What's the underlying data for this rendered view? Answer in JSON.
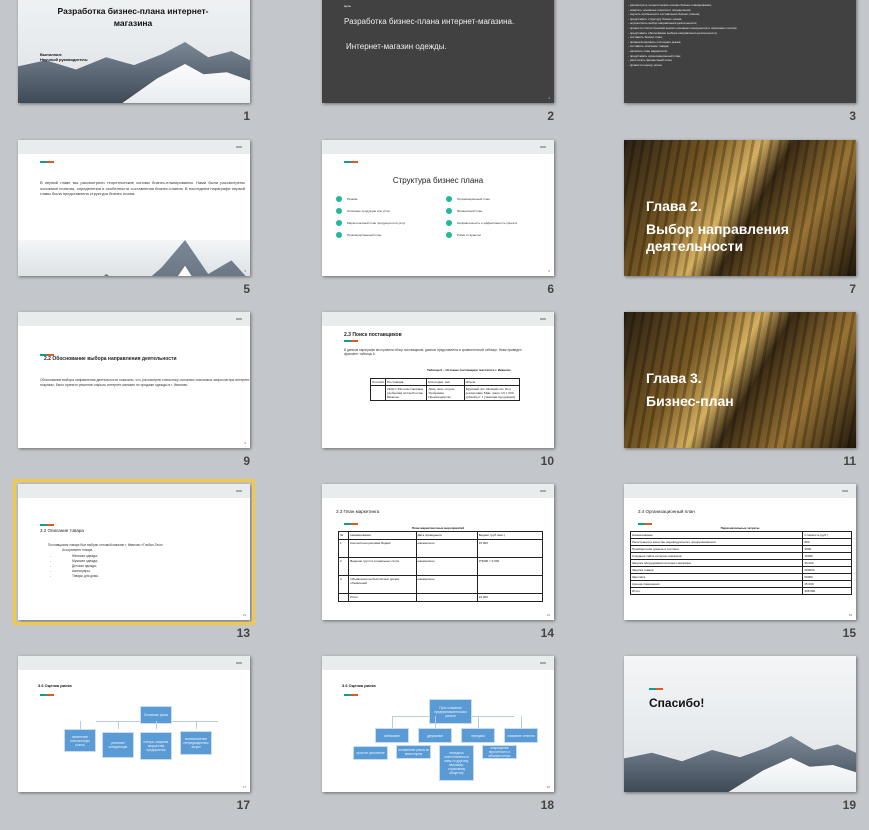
{
  "view": "slide-sorter",
  "selected_slide": 13,
  "colors": {
    "background": "#c3c6ca",
    "selection": "#f2c84b",
    "accent_teal": "#129c8a",
    "accent_orange": "#e45a1c",
    "dark_slide": "#414141",
    "diagram_box": "#5b9bd5"
  },
  "slides": [
    {
      "num": "1",
      "type": "photo-title",
      "title": "Разработка бизнес-плана интернет-магазина",
      "lines": [
        "Выполнил:",
        "Научный руководитель:"
      ]
    },
    {
      "num": "2",
      "type": "dark",
      "label": "Цель",
      "title": "Разработка бизнес-плана интернет-магазина.",
      "subtitle": "Интернет-магазин одежды."
    },
    {
      "num": "3",
      "type": "dark-list",
      "lines": [
        "- рассмотреть теоретические основы бизнес-планирования;",
        "- осветить основные понятия и определения;",
        "- изучить особенности составления бизнес-планов;",
        "- представить структуру бизнес-плана;",
        "- осуществить выбор направления деятельности;",
        "- провести статистический анализ основных конкурентов и поисковых систем;",
        "- представить обоснование выбора направления деятельности;",
        "- составить бизнес-план;",
        "- проанализировать состояние рынка;",
        "- составить описание товара;",
        "- написать план маркетинга;",
        "- представить организационный план;",
        "- рассчитать финансовый план;",
        "- провести оценку риска."
      ]
    },
    {
      "num": "5",
      "type": "text-photo",
      "text": "В первой главе мы рассмотрели теоретические основы бизнес-планирования. Нами были рассмотрены основные понятия, определения и особенности составления бизнес-планов. В последнем параграфе первой главы была представлена структура бизнес плана."
    },
    {
      "num": "6",
      "type": "structure",
      "title": "Структура бизнес плана",
      "items": [
        "Резюме",
        "Описание продукции или услуг",
        "Маркетинговый план продукции или услуг",
        "Производственный план",
        "Организационный план",
        "Финансовый план",
        "Направленность и эффективность проекта",
        "Риски и гарантии"
      ]
    },
    {
      "num": "7",
      "type": "chapter",
      "title": "Глава 2.",
      "subtitle": "Выбор направления деятельности"
    },
    {
      "num": "9",
      "type": "text",
      "title": "2.2 Обоснование выбора направления деятельности",
      "text": "Обоснование выбора направления деятельности показало, что, рассмотрев статистику основных поисковых запросов при интернет-покупках, было принято решение открыть интернет-магазин по продаже одежды в г. Иваново."
    },
    {
      "num": "10",
      "type": "suppliers",
      "title": "2.3 Поиск поставщиков",
      "text": "В данном параграфе мы провели обзор поставщиков, данные представлены в сравнительной таблице. Ниже приведен фрагмент таблицы 6.",
      "caption": "Таблица 6 – Оптовые поставщики текстиля в г. Иваново",
      "headers": [
        "Логотип",
        "Поставщик",
        "Категория, тип",
        "Объем"
      ],
      "rows": [
        [
          "",
          "ООО СТК: качественные удобрения оптом Россия, Иваново",
          "Дети, жен, отороч, Удобрения Производители",
          "Крупный опт, Мелкий опт, Под реализацию Мин. заказ: От 1 000 рублей (от 1 упаковки продукции)"
        ]
      ]
    },
    {
      "num": "11",
      "type": "chapter",
      "title": "Глава 3.",
      "subtitle": "Бизнес-план"
    },
    {
      "num": "13",
      "type": "goods",
      "title": "3.2 Описание товара",
      "text": "Поставщиком товара был выбран оптовый магазин г. Иваново «Глобал-Текс»",
      "sub": "Ассортимент товара",
      "items": [
        "Женская одежда;",
        "Мужская одежда;",
        "Детская одежда;",
        "Аксессуары;",
        "Товары для дома."
      ]
    },
    {
      "num": "14",
      "type": "table",
      "title": "3.3 План маркетинга",
      "caption": "План маркетинговых мероприятий",
      "headers": [
        "№",
        "Наименование",
        "Дата проведения",
        "Бюджет (руб./мес.)"
      ],
      "rows": [
        [
          "1",
          "Контекстная реклама Яндекс",
          "ежемесячно",
          "15 000"
        ],
        [
          "2",
          "Ведение групп в социальных сетях",
          "ежемесячно",
          "3*3000 = 9 000"
        ],
        [
          "3",
          "Объявления на бесплатных досках объявлений",
          "ежемесячно",
          ""
        ],
        [
          "",
          "Итого",
          "",
          "24 000"
        ]
      ]
    },
    {
      "num": "15",
      "type": "table",
      "title": "3.4 Организационный план",
      "caption": "Первоначальные затраты",
      "headers": [
        "Наименование",
        "Стоимость (руб.)"
      ],
      "rows": [
        [
          "Регистрация в качестве индивидуального предпринимателя",
          "800"
        ],
        [
          "Приобретение домена и хостинга",
          "3000"
        ],
        [
          "Создание сайта интернет-магазина",
          "15000"
        ],
        [
          "Закупка оборудования интернет-магазина",
          "35 000"
        ],
        [
          "Закупка товара",
          "200000"
        ],
        [
          "Зарплата",
          "60000"
        ],
        [
          "Аренда помещения",
          "25 000"
        ],
        [
          "Итого",
          "338 800"
        ]
      ]
    },
    {
      "num": "17",
      "type": "risk1",
      "title": "3.6 Оценка риска",
      "root": "Основные риски",
      "children": [
        "изменение конъюнктуры рынка",
        "усиление конкуренции",
        "потеря, хищение имущества предприятия",
        "возникновение непредвиденных затрат"
      ]
    },
    {
      "num": "18",
      "type": "risk2",
      "title": "3.6 Оценка риска",
      "root": "Пути снижения предпринимательских рисков",
      "children": [
        "избежание",
        "удержание",
        "передача",
        "снижение степени"
      ],
      "grandchildren": [
        "простое уклонение",
        "оставление риска за инвестором",
        "передача ответственности кому-то другому, например, страховому обществу",
        "сокращение вероятности и объема потерь"
      ]
    },
    {
      "num": "19",
      "type": "thanks",
      "title": "Спасибо!"
    }
  ]
}
